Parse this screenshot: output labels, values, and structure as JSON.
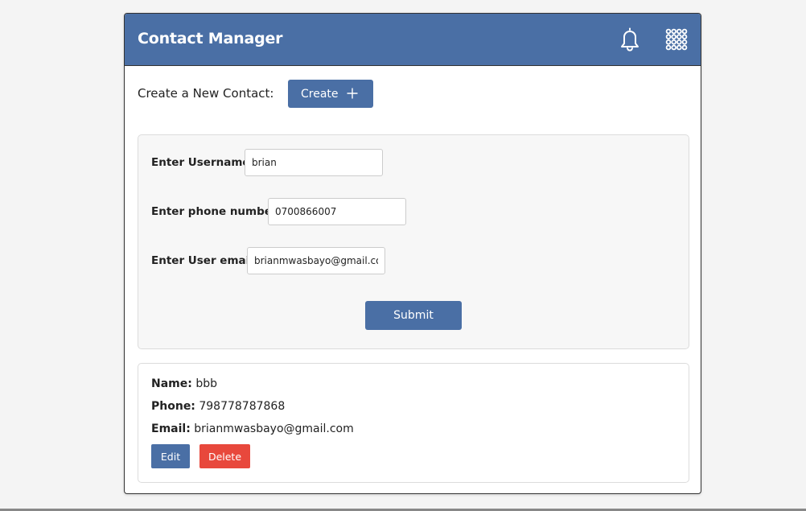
{
  "header": {
    "title": "Contact Manager",
    "bell_icon": "bell-icon",
    "apps_icon": "apps-grid-icon",
    "header_color": "#4a6fa5"
  },
  "create": {
    "label": "Create a New Contact:",
    "button_label": "Create",
    "button_icon": "plus-icon"
  },
  "form": {
    "username_label": "Enter Username:",
    "username_value": "brian",
    "phone_label": "Enter phone number:",
    "phone_value": "0700866007",
    "email_label": "Enter User email:",
    "email_value": "brianmwasbayo@gmail.com",
    "submit_label": "Submit"
  },
  "contacts": [
    {
      "name_label": "Name:",
      "name": "bbb",
      "phone_label": "Phone:",
      "phone": "798778787868",
      "email_label": "Email:",
      "email": "brianmwasbayo@gmail.com",
      "edit_label": "Edit",
      "delete_label": "Delete"
    }
  ],
  "colors": {
    "primary": "#4a6fa5",
    "danger": "#e8483c"
  }
}
